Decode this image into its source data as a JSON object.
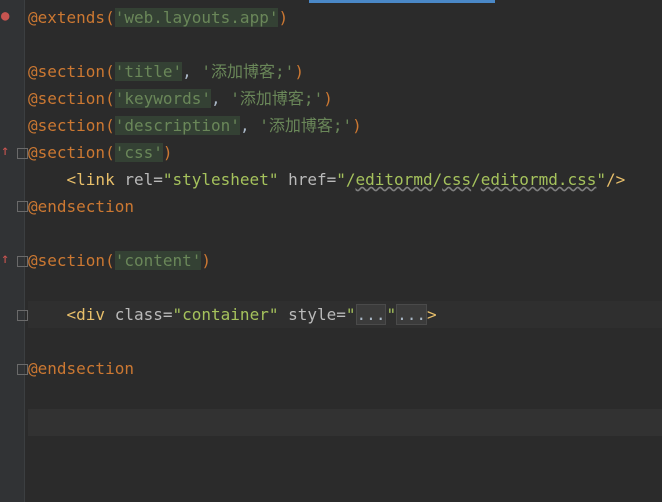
{
  "editor": {
    "lines": [
      {
        "id": "l1",
        "parts": [
          [
            "kw",
            "@extends("
          ],
          [
            "strbox",
            "'web.layouts.app'"
          ],
          [
            "kw",
            ")"
          ]
        ]
      },
      {
        "id": "l2",
        "parts": []
      },
      {
        "id": "l3",
        "parts": [
          [
            "kw",
            "@section("
          ],
          [
            "strbox",
            "'title'"
          ],
          [
            "plain",
            ", "
          ],
          [
            "str",
            "'添加博客;'"
          ],
          [
            "kw",
            ")"
          ]
        ]
      },
      {
        "id": "l4",
        "parts": [
          [
            "kw",
            "@section("
          ],
          [
            "strbox",
            "'keywords'"
          ],
          [
            "plain",
            ", "
          ],
          [
            "str",
            "'添加博客;'"
          ],
          [
            "kw",
            ")"
          ]
        ]
      },
      {
        "id": "l5",
        "parts": [
          [
            "kw",
            "@section("
          ],
          [
            "strbox",
            "'description'"
          ],
          [
            "plain",
            ", "
          ],
          [
            "str",
            "'添加博客;'"
          ],
          [
            "kw",
            ")"
          ]
        ]
      },
      {
        "id": "l6",
        "parts": [
          [
            "kw",
            "@section("
          ],
          [
            "strbox",
            "'css'"
          ],
          [
            "kw",
            ")"
          ]
        ]
      },
      {
        "id": "l7",
        "parts": [
          [
            "plain",
            "    "
          ],
          [
            "tag",
            "<link "
          ],
          [
            "attr",
            "rel="
          ],
          [
            "aval",
            "\"stylesheet\""
          ],
          [
            "attr",
            " href="
          ],
          [
            "aval",
            "\"/"
          ],
          [
            "under",
            "editormd"
          ],
          [
            "aval",
            "/"
          ],
          [
            "under",
            "css"
          ],
          [
            "aval",
            "/"
          ],
          [
            "under",
            "editormd.css"
          ],
          [
            "aval",
            "\""
          ],
          [
            "tag",
            "/>"
          ]
        ]
      },
      {
        "id": "l8",
        "parts": [
          [
            "kw",
            "@endsection"
          ]
        ]
      },
      {
        "id": "l9",
        "parts": []
      },
      {
        "id": "l10",
        "parts": [
          [
            "kw",
            "@section("
          ],
          [
            "strbox",
            "'content'"
          ],
          [
            "kw",
            ")"
          ]
        ]
      },
      {
        "id": "l11",
        "parts": []
      },
      {
        "id": "l12",
        "parts": [
          [
            "plain",
            "    "
          ],
          [
            "tag",
            "<div "
          ],
          [
            "attr",
            "class="
          ],
          [
            "aval",
            "\"container\""
          ],
          [
            "attr",
            " style="
          ],
          [
            "aval",
            "\""
          ],
          [
            "fold",
            "..."
          ],
          [
            "aval",
            "\""
          ],
          [
            "fold",
            "..."
          ],
          [
            "tag",
            ">"
          ]
        ]
      },
      {
        "id": "l13",
        "parts": []
      },
      {
        "id": "l14",
        "parts": [
          [
            "kw",
            "@endsection"
          ]
        ]
      },
      {
        "id": "l15",
        "parts": []
      },
      {
        "id": "l16",
        "parts": []
      }
    ]
  },
  "colors": {
    "background": "#2b2b2b",
    "keyword": "#cc7832",
    "string": "#6a8759",
    "tag": "#e8bf6a",
    "attr_value": "#a5c25c",
    "gutter": "#313335",
    "error_marker": "#c75450"
  }
}
